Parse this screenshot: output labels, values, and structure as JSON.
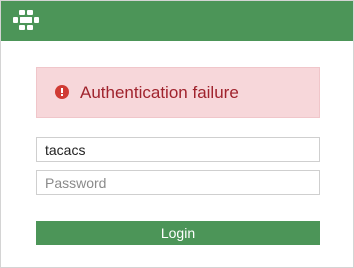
{
  "header": {
    "logo_icon": "fortinet-logo-icon",
    "background_color": "#4c9558"
  },
  "alert": {
    "icon": "error-exclamation-icon",
    "message": "Authentication failure",
    "background_color": "#f7d7da",
    "text_color": "#a0232d"
  },
  "form": {
    "username_value": "tacacs",
    "password_placeholder": "Password",
    "login_label": "Login",
    "button_color": "#4c9558"
  }
}
